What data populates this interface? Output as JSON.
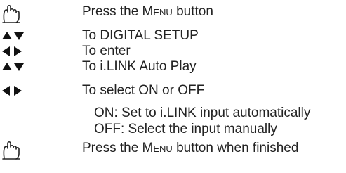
{
  "steps": [
    {
      "icon": "menu-hand-icon",
      "pre": "Press the ",
      "key": "Menu",
      "post": " button"
    },
    {
      "icon": "up-down-arrows-icon",
      "text": "To DIGITAL SETUP"
    },
    {
      "icon": "left-right-arrows-icon",
      "text": "To enter"
    },
    {
      "icon": "up-down-arrows-icon",
      "text": "To i.LINK Auto Play"
    },
    {
      "icon": "left-right-arrows-icon",
      "text": "To select ON or OFF"
    },
    {
      "icon": "menu-hand-icon",
      "pre": "Press the ",
      "key": "Menu",
      "post": " button when finished"
    }
  ],
  "options": [
    "ON:  Set to i.LINK input automatically",
    "OFF:  Select the input manually"
  ]
}
